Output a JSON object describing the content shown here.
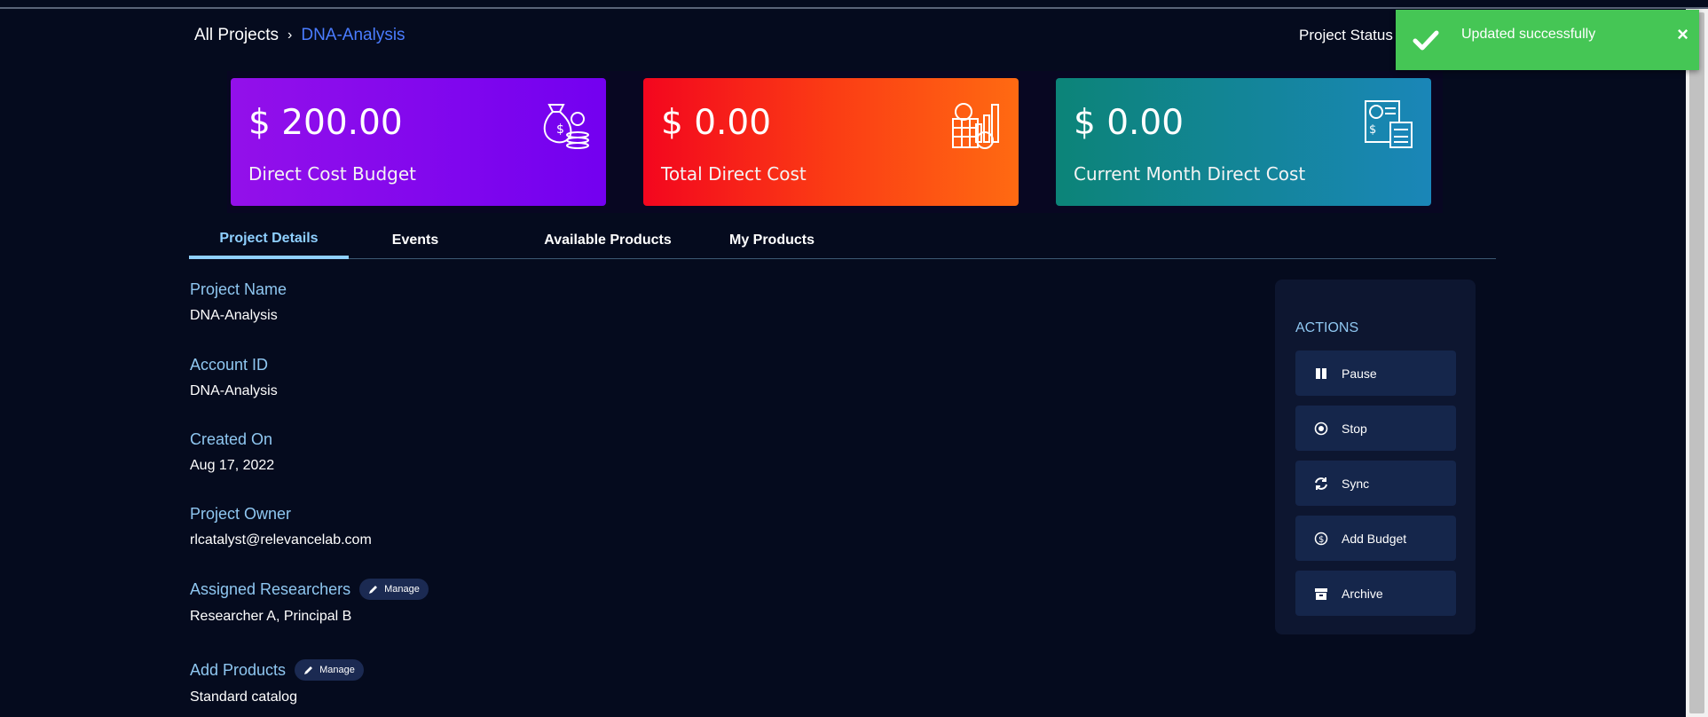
{
  "breadcrumb": {
    "root": "All Projects",
    "separator": "›",
    "current": "DNA-Analysis"
  },
  "header": {
    "status_label": "Project Status :"
  },
  "cards": [
    {
      "amount": "$ 200.00",
      "label": "Direct Cost Budget",
      "icon": "money-bag-icon"
    },
    {
      "amount": "$ 0.00",
      "label": "Total Direct Cost",
      "icon": "cost-chart-icon"
    },
    {
      "amount": "$ 0.00",
      "label": "Current Month Direct Cost",
      "icon": "report-calculator-icon"
    }
  ],
  "tabs": [
    "Project Details",
    "Events",
    "Available Products",
    "My Products"
  ],
  "details": {
    "project_name": {
      "label": "Project Name",
      "value": "DNA-Analysis"
    },
    "account_id": {
      "label": "Account ID",
      "value": "DNA-Analysis"
    },
    "created_on": {
      "label": "Created On",
      "value": "Aug 17, 2022"
    },
    "project_owner": {
      "label": "Project Owner",
      "value": "rlcatalyst@relevancelab.com"
    },
    "researchers": {
      "label": "Assigned Researchers",
      "manage": "Manage",
      "value": "Researcher A, Principal B"
    },
    "products": {
      "label": "Add Products",
      "manage": "Manage",
      "value": "Standard catalog"
    }
  },
  "actions": {
    "title": "ACTIONS",
    "items": [
      "Pause",
      "Stop",
      "Sync",
      "Add Budget",
      "Archive"
    ]
  },
  "toast": {
    "message": "Updated successfully",
    "close": "×",
    "color": "#45c655"
  },
  "colors": {
    "accent": "#8fd0ff",
    "link": "#4a7cff",
    "background": "#050b1e"
  }
}
